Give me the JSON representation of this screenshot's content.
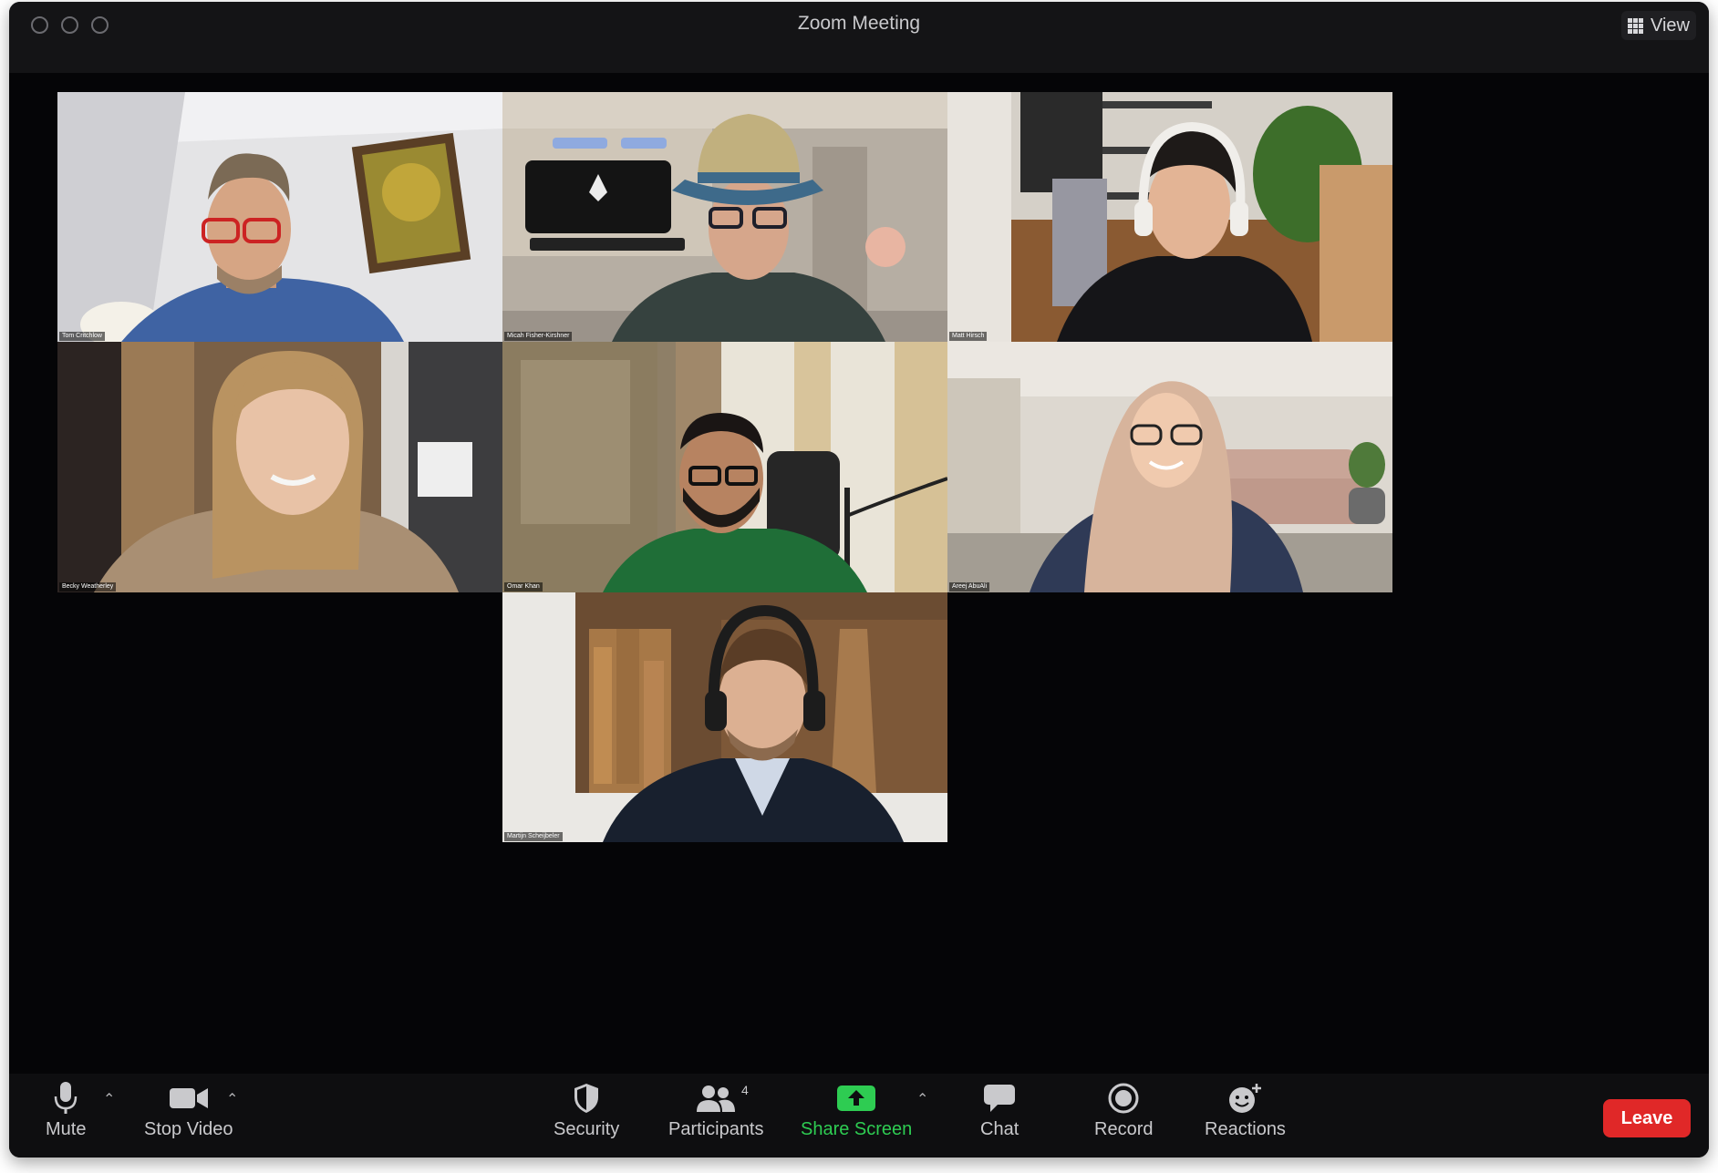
{
  "window": {
    "title": "Zoom Meeting",
    "view_label": "View"
  },
  "participants": [
    {
      "name": "Tom Critchlow"
    },
    {
      "name": "Micah Fisher-Kirshner"
    },
    {
      "name": "Matt Hirsch"
    },
    {
      "name": "Becky Weatherley"
    },
    {
      "name": "Omar Khan"
    },
    {
      "name": "Areej AbuAli"
    },
    {
      "name": "Martijn Scheijbeler"
    }
  ],
  "toolbar": {
    "mute_label": "Mute",
    "stop_video_label": "Stop Video",
    "security_label": "Security",
    "participants_label": "Participants",
    "participants_count": "4",
    "share_screen_label": "Share Screen",
    "chat_label": "Chat",
    "record_label": "Record",
    "reactions_label": "Reactions",
    "leave_label": "Leave"
  },
  "colors": {
    "accent_green": "#2ecc52",
    "leave_red": "#e02828",
    "background": "#050507"
  }
}
